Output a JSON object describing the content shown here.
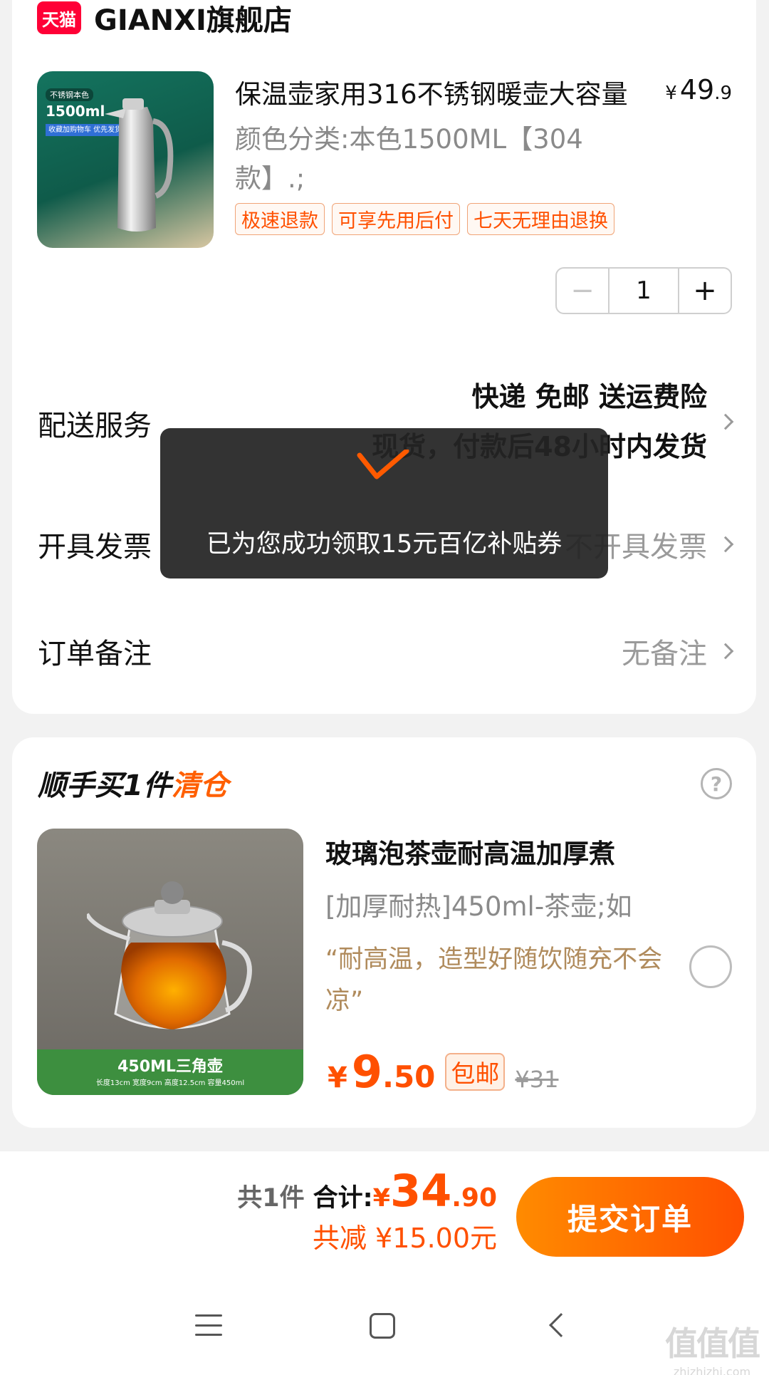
{
  "store": {
    "badge": "天猫",
    "name": "GIANXI旗舰店"
  },
  "product": {
    "image_tags": [
      "不锈钢本色",
      "1500ml",
      "收藏加购物车 优先发货"
    ],
    "title": "保温壶家用316不锈钢暖壶大容量",
    "price_currency": "¥",
    "price_int": "49",
    "price_dec": ".9",
    "sku": "颜色分类:本色1500ML【304款】.;",
    "tags": [
      "极速退款",
      "可享先用后付",
      "七天无理由退换"
    ],
    "quantity": "1",
    "minus_icon": "−",
    "plus_icon": "+"
  },
  "delivery": {
    "label": "配送服务",
    "line1": "快递 免邮 送运费险",
    "line2": "现货，付款后48小时内发货"
  },
  "invoice": {
    "label": "开具发票",
    "value": "不开具发票"
  },
  "remark": {
    "label": "订单备注",
    "value": "无备注"
  },
  "addon": {
    "title_prefix": "顺手买1件",
    "title_highlight": "清仓",
    "help_icon": "?",
    "image_band": "450ML三角壶",
    "image_band_small": "长度13cm  宽度9cm  高度12.5cm  容量450ml",
    "title": "玻璃泡茶壶耐高温加厚煮",
    "sku": "[加厚耐热]450ml-茶壶;如",
    "review": "“耐高温，造型好随饮随充不会凉”",
    "price_currency": "¥",
    "price_int": "9",
    "price_dec": ".50",
    "free_shipping": "包邮",
    "original_price": "¥31"
  },
  "summary": {
    "count": "共1件",
    "total_label": "合计:",
    "total_currency": "¥",
    "total_int": "34",
    "total_dec": ".90",
    "saving": "共减 ¥15.00元",
    "submit": "提交订单"
  },
  "toast": {
    "icon": "checkmark-icon",
    "message": "已为您成功领取15元百亿补贴券"
  },
  "watermark": {
    "main": "值值值",
    "url": "zhizhizhi.com"
  },
  "colors": {
    "accent": "#ff5000",
    "tmall_red": "#ff0036",
    "review_brown": "#b08b5c"
  }
}
